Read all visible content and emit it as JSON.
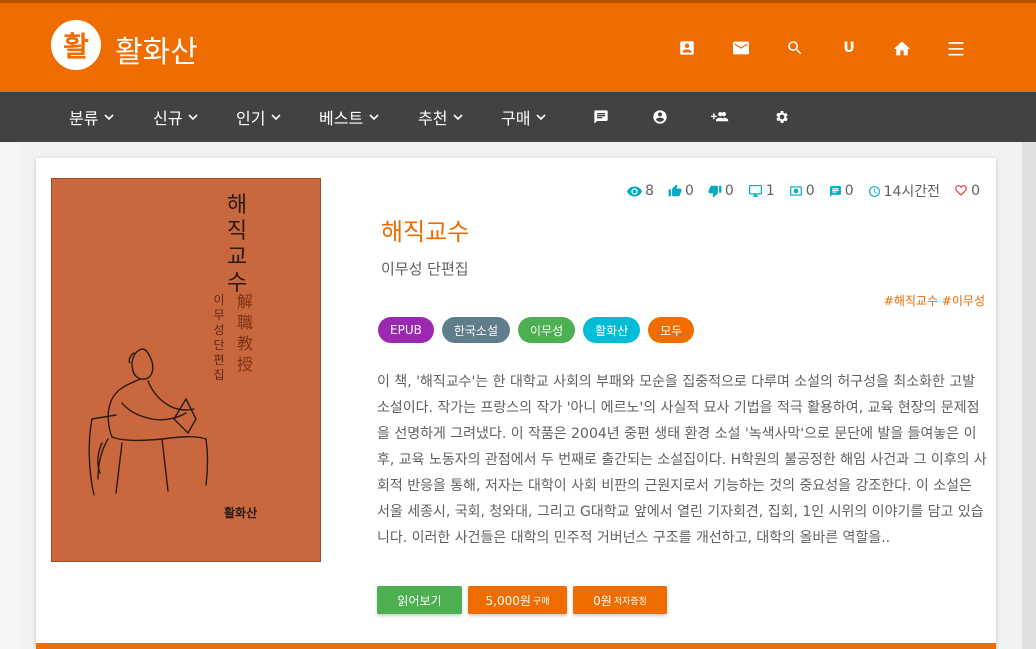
{
  "header": {
    "logo_char": "활",
    "brand": "활화산",
    "user_initial": "U",
    "icons": [
      "account-box-icon",
      "mail-icon",
      "search-icon",
      "user-initial",
      "home-icon",
      "menu-icon"
    ]
  },
  "nav": {
    "items": [
      {
        "label": "분류"
      },
      {
        "label": "신규"
      },
      {
        "label": "인기"
      },
      {
        "label": "베스트"
      },
      {
        "label": "추천"
      },
      {
        "label": "구매"
      }
    ],
    "icons": [
      "chat-icon",
      "account-circle-icon",
      "group-add-icon",
      "settings-icon"
    ]
  },
  "book": {
    "cover": {
      "title_vertical": "해직교수",
      "author_vertical": "이무성 단편집",
      "hanja": "解職教授",
      "publisher": "활화산"
    },
    "stats": {
      "views": "8",
      "likes": "0",
      "dislikes": "0",
      "displays": "1",
      "money": "0",
      "comments": "0",
      "time": "14시간전",
      "favorites": "0"
    },
    "title": "해직교수",
    "subtitle": "이무성 단편집",
    "hashtags": "#해직교수 #이무성",
    "chips": [
      {
        "label": "EPUB",
        "color": "#9c27b0"
      },
      {
        "label": "한국소설",
        "color": "#607d8b"
      },
      {
        "label": "이무성",
        "color": "#4caf50"
      },
      {
        "label": "활화산",
        "color": "#00bcd4"
      },
      {
        "label": "모두",
        "color": "#ef6c00"
      }
    ],
    "description": "이 책, '해직교수'는 한 대학교 사회의 부패와 모순을 집중적으로 다루며 소설의 허구성을 최소화한 고발 소설이다. 작가는 프랑스의 작가 '아니 에르노'의 사실적 묘사 기법을 적극 활용하여, 교육 현장의 문제점을 선명하게 그려냈다. 이 작품은 2004년 중편 생태 환경 소설 '녹색사막'으로 문단에 발을 들여놓은 이후, 교육 노동자의 관점에서 두 번째로 출간되는 소설집이다. H학원의 불공정한 해임 사건과 그 이후의 사회적 반응을 통해, 저자는 대학이 사회 비판의 근원지로서 기능하는 것의 중요성을 강조한다. 이 소설은 서울 세종시, 국회, 청와대, 그리고 G대학교 앞에서 열린 기자회견, 집회, 1인 시위의 이야기를 담고 있습니다. 이러한 사건들은 대학의 민주적 거버넌스 구조를 개선하고, 대학의 올바른 역할을..",
    "actions": {
      "read": "읽어보기",
      "buy_price": "5,000원",
      "buy_label": "구매",
      "donate_price": "0원",
      "donate_label": "저자증정"
    }
  },
  "colors": {
    "primary": "#ef6c00",
    "nav_bg": "#424242",
    "stat_icon": "#00acc1",
    "read_button": "#4caf50"
  }
}
